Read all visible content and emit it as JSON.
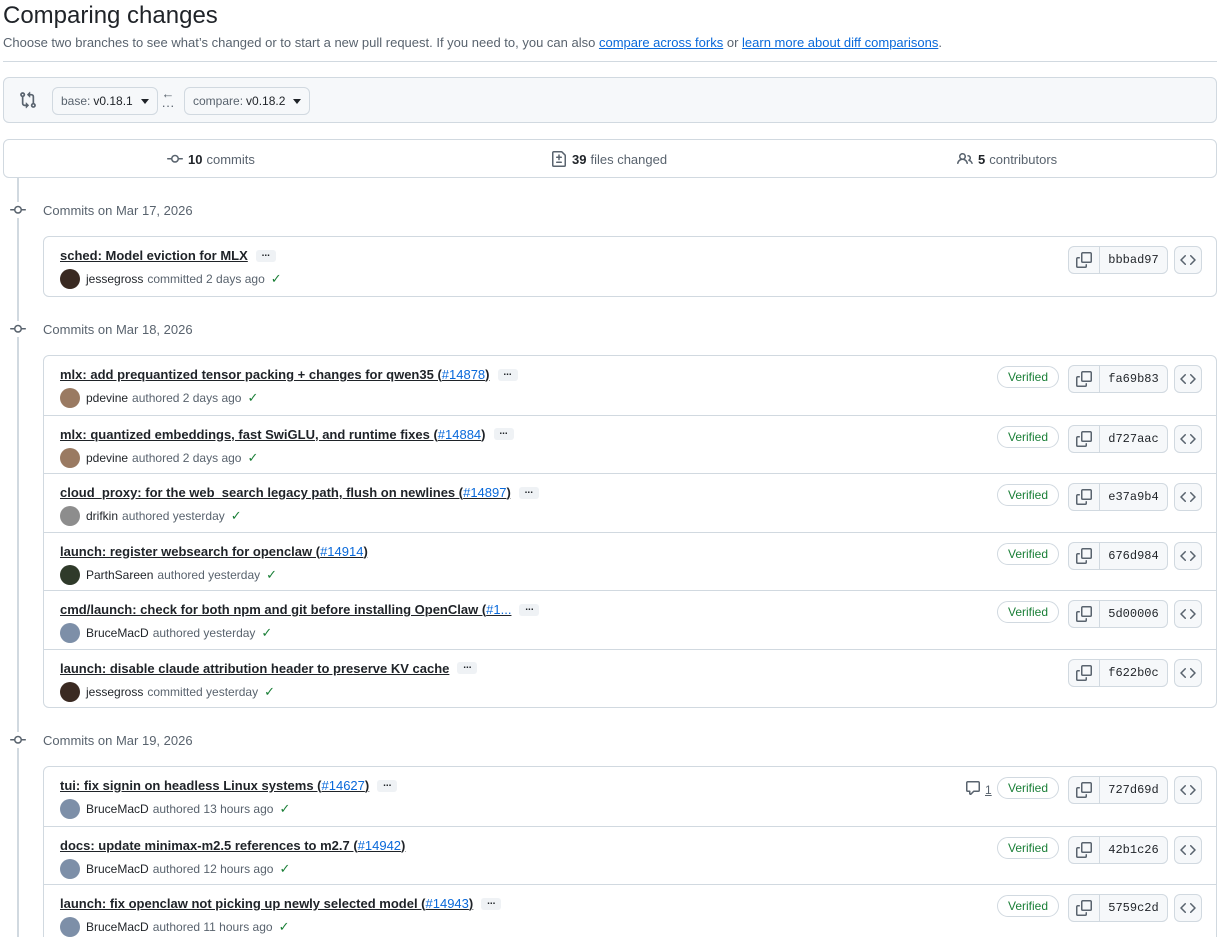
{
  "header": {
    "title": "Comparing changes",
    "subtitle_prefix": "Choose two branches to see what’s changed or to start a new pull request. If you need to, you can also ",
    "link_forks": "compare across forks",
    "subtitle_mid": " or ",
    "link_learn": "learn more about diff comparisons",
    "subtitle_end": "."
  },
  "range": {
    "base_label": "base:",
    "base_value": "v0.18.1",
    "compare_label": "compare:",
    "compare_value": "v0.18.2"
  },
  "stats": {
    "commits_count": "10",
    "commits_label": "commits",
    "files_count": "39",
    "files_label": "files changed",
    "contributors_count": "5",
    "contributors_label": "contributors"
  },
  "groups": [
    {
      "heading": "Commits on Mar 17, 2026",
      "commits": [
        {
          "title": "sched: Model eviction for MLX",
          "pr": "",
          "suffix": "",
          "author": "jessegross",
          "action": "committed 2 days ago",
          "verified": "",
          "comments": "",
          "sha": "bbbad97",
          "ellipsis": true,
          "avatar": "#3a2a22"
        }
      ]
    },
    {
      "heading": "Commits on Mar 18, 2026",
      "commits": [
        {
          "title": "mlx: add prequantized tensor packing + changes for qwen35 (",
          "pr": "#14878",
          "suffix": ")",
          "author": "pdevine",
          "action": "authored 2 days ago",
          "verified": "Verified",
          "comments": "",
          "sha": "fa69b83",
          "ellipsis": true,
          "avatar": "#9a7a62"
        },
        {
          "title": "mlx: quantized embeddings, fast SwiGLU, and runtime fixes (",
          "pr": "#14884",
          "suffix": ")",
          "author": "pdevine",
          "action": "authored 2 days ago",
          "verified": "Verified",
          "comments": "",
          "sha": "d727aac",
          "ellipsis": true,
          "avatar": "#9a7a62"
        },
        {
          "title": "cloud_proxy: for the web_search legacy path, flush on newlines (",
          "pr": "#14897",
          "suffix": ")",
          "author": "drifkin",
          "action": "authored yesterday",
          "verified": "Verified",
          "comments": "",
          "sha": "e37a9b4",
          "ellipsis": true,
          "avatar": "#8d8d8d"
        },
        {
          "title": "launch: register websearch for openclaw (",
          "pr": "#14914",
          "suffix": ")",
          "author": "ParthSareen",
          "action": "authored yesterday",
          "verified": "Verified",
          "comments": "",
          "sha": "676d984",
          "ellipsis": false,
          "avatar": "#2f3a2a"
        },
        {
          "title": "cmd/launch: check for both npm and git before installing OpenClaw (",
          "pr": "#1...",
          "suffix": "",
          "author": "BruceMacD",
          "action": "authored yesterday",
          "verified": "Verified",
          "comments": "",
          "sha": "5d00006",
          "ellipsis": true,
          "avatar": "#7d8fa8"
        },
        {
          "title": "launch: disable claude attribution header to preserve KV cache",
          "pr": "",
          "suffix": "",
          "author": "jessegross",
          "action": "committed yesterday",
          "verified": "",
          "comments": "",
          "sha": "f622b0c",
          "ellipsis": true,
          "avatar": "#3a2a22"
        }
      ]
    },
    {
      "heading": "Commits on Mar 19, 2026",
      "commits": [
        {
          "title": "tui: fix signin on headless Linux systems (",
          "pr": "#14627",
          "suffix": ")",
          "author": "BruceMacD",
          "action": "authored 13 hours ago",
          "verified": "Verified",
          "comments": "1",
          "sha": "727d69d",
          "ellipsis": true,
          "avatar": "#7d8fa8"
        },
        {
          "title": "docs: update minimax-m2.5 references to m2.7 (",
          "pr": "#14942",
          "suffix": ")",
          "author": "BruceMacD",
          "action": "authored 12 hours ago",
          "verified": "Verified",
          "comments": "",
          "sha": "42b1c26",
          "ellipsis": false,
          "avatar": "#7d8fa8"
        },
        {
          "title": "launch: fix openclaw not picking up newly selected model (",
          "pr": "#14943",
          "suffix": ")",
          "author": "BruceMacD",
          "action": "authored 11 hours ago",
          "verified": "Verified",
          "comments": "",
          "sha": "5759c2d",
          "ellipsis": true,
          "avatar": "#7d8fa8"
        }
      ]
    }
  ],
  "colors": {
    "link": "#0969da",
    "verified": "#1a7f37",
    "border": "#d1d9e0"
  }
}
